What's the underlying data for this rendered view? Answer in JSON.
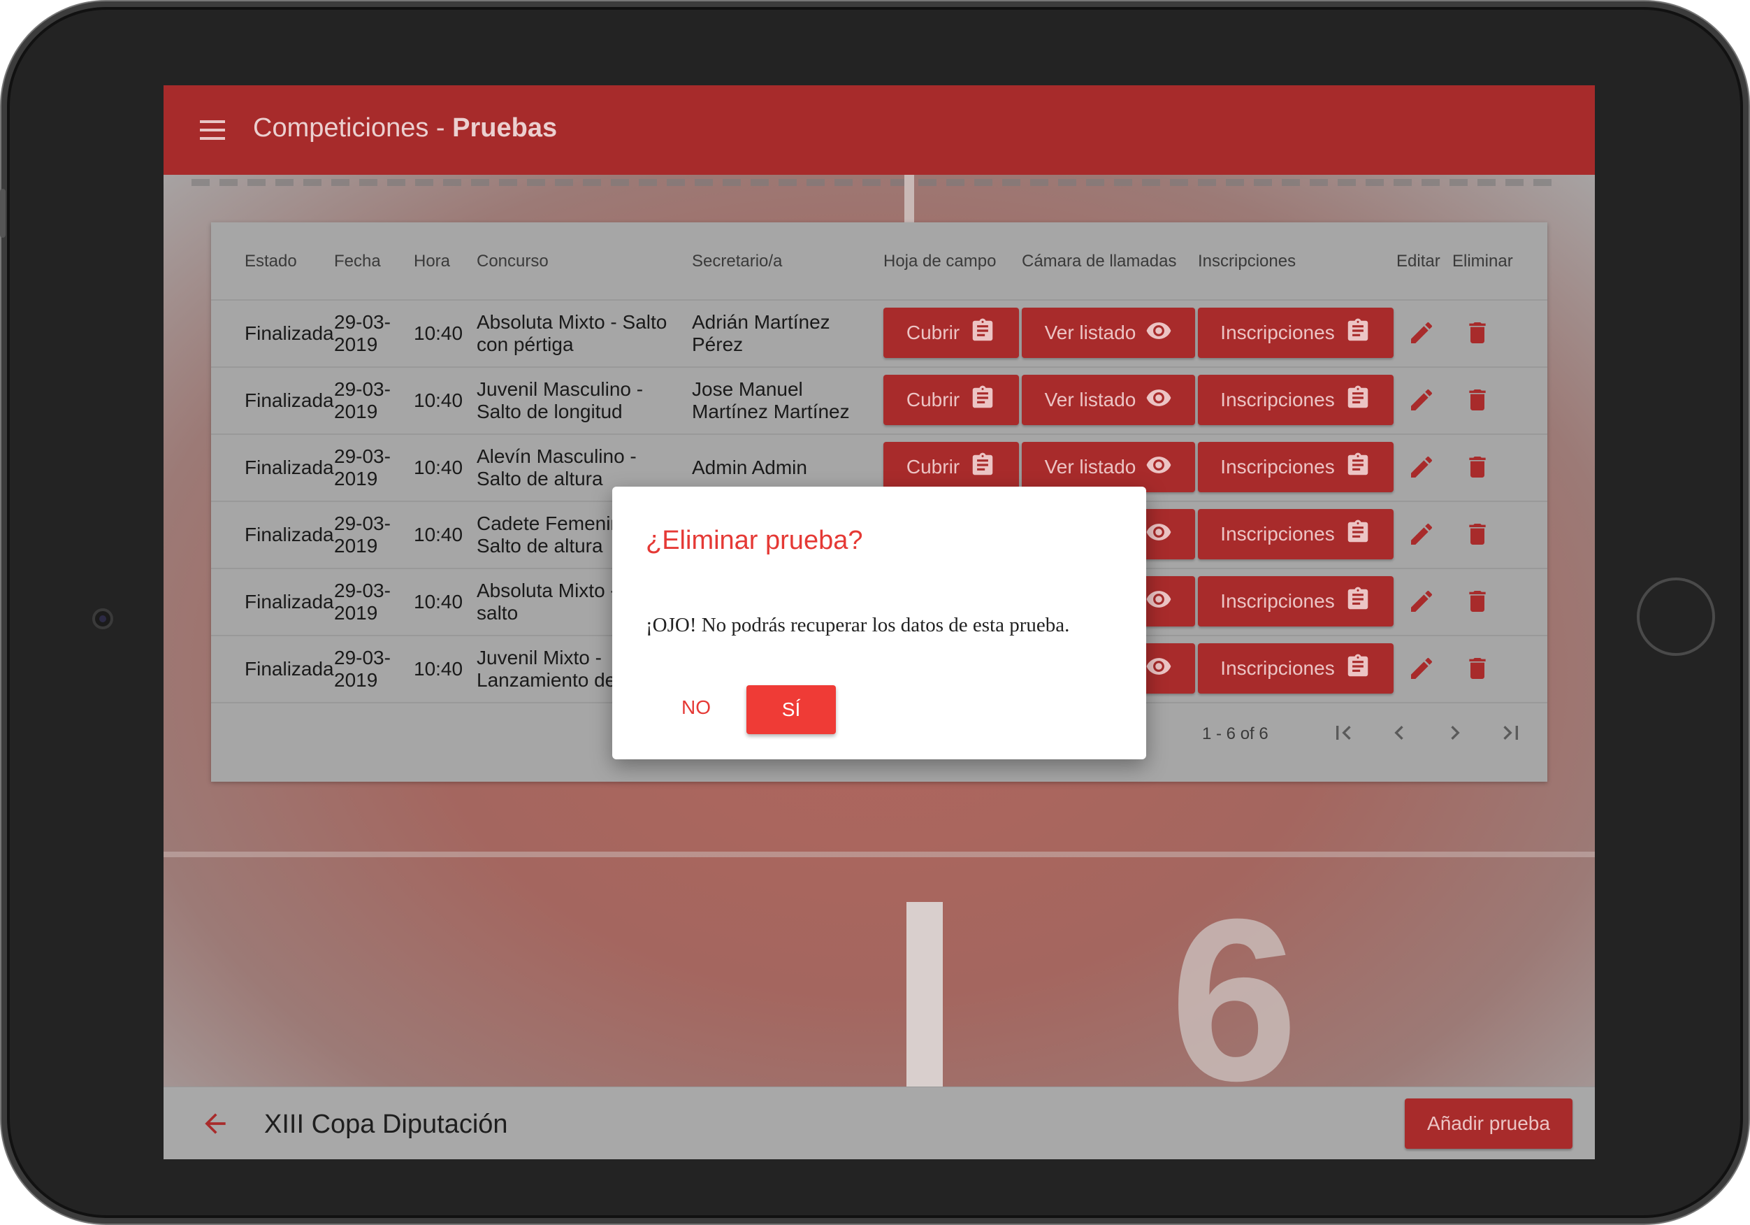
{
  "appbar": {
    "title_prefix": "Competiciones - ",
    "title_bold": "Pruebas"
  },
  "table": {
    "headers": [
      "Estado",
      "Fecha",
      "Hora",
      "Concurso",
      "Secretario/a",
      "Hoja de campo",
      "Cámara de llamadas",
      "Inscripciones",
      "Editar",
      "Eliminar"
    ],
    "rows": [
      {
        "estado": "Finalizada",
        "fecha": "29-03-2019",
        "hora": "10:40",
        "concurso": "Absoluta Mixto - Salto con pértiga",
        "secretario": "Adrián Martínez Pérez"
      },
      {
        "estado": "Finalizada",
        "fecha": "29-03-2019",
        "hora": "10:40",
        "concurso": "Juvenil Masculino - Salto de longitud",
        "secretario": "Jose Manuel Martínez Martínez"
      },
      {
        "estado": "Finalizada",
        "fecha": "29-03-2019",
        "hora": "10:40",
        "concurso": "Alevín Masculino - Salto de altura",
        "secretario": "Admin Admin"
      },
      {
        "estado": "Finalizada",
        "fecha": "29-03-2019",
        "hora": "10:40",
        "concurso": "Cadete Femenino - Salto de altura",
        "secretario": ""
      },
      {
        "estado": "Finalizada",
        "fecha": "29-03-2019",
        "hora": "10:40",
        "concurso": "Absoluta Mixto - Triple salto",
        "secretario": ""
      },
      {
        "estado": "Finalizada",
        "fecha": "29-03-2019",
        "hora": "10:40",
        "concurso": "Juvenil Mixto - Lanzamiento de peso",
        "secretario": ""
      }
    ],
    "buttons": {
      "cubrir": "Cubrir",
      "ver_listado": "Ver listado",
      "inscripciones": "Inscripciones"
    },
    "pagination": "1 - 6 of 6"
  },
  "bottombar": {
    "title": "XIII Copa Diputación",
    "add_button": "Añadir prueba"
  },
  "dialog": {
    "title": "¿Eliminar prueba?",
    "message": "¡OJO! No podrás recuperar los datos de esta prueba.",
    "no": "NO",
    "yes": "SÍ"
  },
  "colors": {
    "primary": "#a72b2b",
    "dialog_accent": "#e53935",
    "overlay": "#a8a8a8"
  },
  "icons": [
    "menu-icon",
    "clipboard-icon",
    "eye-icon",
    "pencil-icon",
    "trash-icon",
    "first-page-icon",
    "chevron-left-icon",
    "chevron-right-icon",
    "last-page-icon",
    "arrow-left-icon"
  ]
}
